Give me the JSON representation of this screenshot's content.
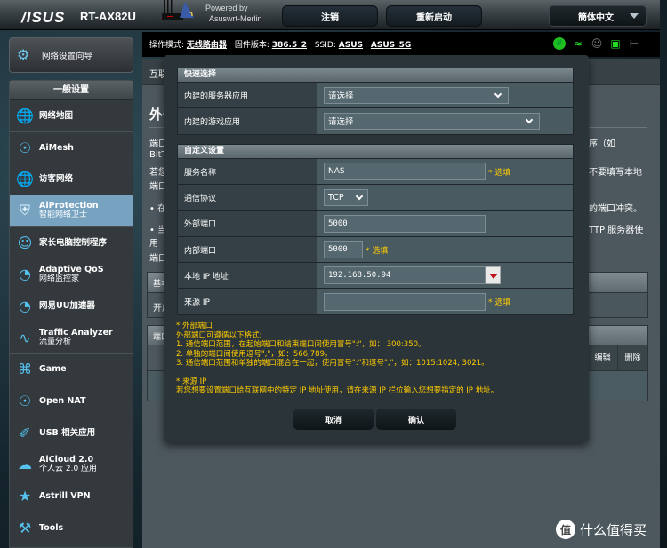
{
  "header": {
    "brand": "/ISUS",
    "model": "RT-AX82U",
    "powered_by_line1": "Powered by",
    "powered_by_line2": "Asuswrt-Merlin",
    "logout_label": "注销",
    "reboot_label": "重新启动",
    "language": "簡体中文"
  },
  "status": {
    "mode_label": "操作模式:",
    "mode_value": "无线路由器",
    "firmware_label": "固件版本:",
    "firmware_value": "386.5_2",
    "ssid_label": "SSID:",
    "ssid_1": "ASUS",
    "ssid_2": "ASUS_5G",
    "icons": [
      "internet-globe-icon",
      "wifi-icon",
      "clients-icon",
      "lan-icon",
      "usb-icon"
    ]
  },
  "sidebar": {
    "qis_label": "网络设置向导",
    "section_title": "一般设置",
    "items": [
      {
        "icon": "network-map-icon",
        "label": "网络地图",
        "sub": ""
      },
      {
        "icon": "aimesh-icon",
        "label": "AiMesh",
        "sub": ""
      },
      {
        "icon": "guest-network-icon",
        "label": "访客网络",
        "sub": ""
      },
      {
        "icon": "aiprotection-icon",
        "label": "AiProtection",
        "sub": "智能网络卫士",
        "active": true
      },
      {
        "icon": "parental-control-icon",
        "label": "家长电脑控制程序",
        "sub": ""
      },
      {
        "icon": "qos-gauge-icon",
        "label": "Adaptive QoS",
        "sub": "网络监控家"
      },
      {
        "icon": "uu-gauge-icon",
        "label": "网易UU加速器",
        "sub": ""
      },
      {
        "icon": "traffic-analyzer-icon",
        "label": "Traffic Analyzer",
        "sub": "流量分析"
      },
      {
        "icon": "gamepad-icon",
        "label": "Game",
        "sub": ""
      },
      {
        "icon": "open-nat-icon",
        "label": "Open NAT",
        "sub": ""
      },
      {
        "icon": "usb-app-icon",
        "label": "USB 相关应用",
        "sub": ""
      },
      {
        "icon": "aicloud-icon",
        "label": "AiCloud 2.0",
        "sub": "个人云 2.0 应用"
      },
      {
        "icon": "astrill-vpn-icon",
        "label": "Astrill VPN",
        "sub": ""
      },
      {
        "icon": "tools-wrench-icon",
        "label": "Tools",
        "sub": ""
      }
    ]
  },
  "background_page": {
    "tab_label": "互联",
    "title": "外部",
    "left_fragments": [
      "端口",
      "BitT",
      "若您",
      "端口",
      "•  在",
      "•  当",
      "   用",
      "端口"
    ],
    "right_fragments": [
      "序（如",
      "不要填写本地",
      "的端口冲突。",
      "TTP 服务器使"
    ],
    "basic_table_header": "基本",
    "basic_table_row": "开启",
    "list_table_header": "端口",
    "edit_col": "编辑",
    "delete_col": "删除"
  },
  "modal": {
    "quick_section_title": "快速选择",
    "server_app_label": "内建的服务器应用",
    "server_app_value": "请选择",
    "game_app_label": "内建的游戏应用",
    "game_app_value": "请选择",
    "custom_section_title": "自定义设置",
    "service_name_label": "服务名称",
    "service_name_value": "NAS",
    "optional_note": "* 选填",
    "protocol_label": "通信协议",
    "protocol_value": "TCP",
    "external_port_label": "外部端口",
    "external_port_value": "5000",
    "internal_port_label": "内部端口",
    "internal_port_value": "5000",
    "local_ip_label": "本地 IP 地址",
    "local_ip_value": "192.168.50.94",
    "source_ip_label": "来源 IP",
    "source_ip_value": "",
    "notes": [
      "* 外部端口",
      "外部端口可遵循以下格式:",
      "1. 通信端口范围，在起始端口和结束端口间使用冒号\":\"，如： 300:350。",
      "2. 单独的端口间使用逗号\",\"，如：566,789。",
      "3. 通信端口范围和单独的端口混合在一起，使用冒号\":\"和逗号\",\"，如：1015:1024, 3021。"
    ],
    "notes2": [
      "* 来源 IP",
      "若您想要设置端口给互联网中的特定 IP 地址使用，请在来源 IP 栏位输入您想要指定的 IP 地址。"
    ],
    "cancel_label": "取消",
    "confirm_label": "确认"
  },
  "watermark": {
    "glyph": "值",
    "text": "什么值得买"
  },
  "colors": {
    "accent_blue": "#55c2ef",
    "active_item": "#77a3c1",
    "note_yellow": "#ffcc00",
    "status_green": "#22dd22"
  }
}
